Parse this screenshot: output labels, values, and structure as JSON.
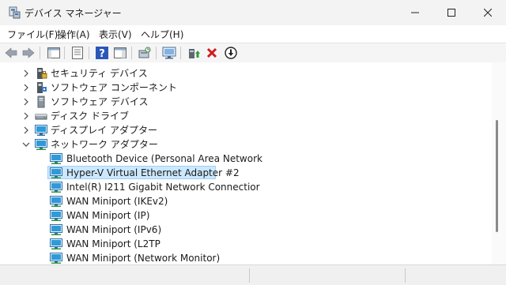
{
  "window": {
    "title": "デバイス マネージャー",
    "app_icon": "device-manager-icon",
    "controls": [
      "minimize-icon",
      "maximize-icon",
      "close-icon"
    ]
  },
  "menubar": {
    "items": [
      {
        "label": "ファイル(F)"
      },
      {
        "label": "操作(A)"
      },
      {
        "label": "表示(V)"
      },
      {
        "label": "ヘルプ(H)"
      }
    ]
  },
  "toolbar": {
    "buttons": [
      "back-icon",
      "forward-icon",
      "console-tree-icon",
      "properties-icon",
      "help-icon",
      "action-pane-icon",
      "scan-hardware-icon",
      "display-icon",
      "enable-device-icon",
      "uninstall-icon",
      "update-driver-icon"
    ]
  },
  "tree": {
    "categories": [
      {
        "label": "セキュリティ デバイス",
        "icon": "security-device-icon",
        "expanded": false
      },
      {
        "label": "ソフトウェア コンポーネント",
        "icon": "software-component-icon",
        "expanded": false
      },
      {
        "label": "ソフトウェア デバイス",
        "icon": "software-device-icon",
        "expanded": false
      },
      {
        "label": "ディスク ドライブ",
        "icon": "disk-drive-icon",
        "expanded": false
      },
      {
        "label": "ディスプレイ アダプター",
        "icon": "display-adapter-icon",
        "expanded": false
      },
      {
        "label": "ネットワーク アダプター",
        "icon": "network-adapter-icon",
        "expanded": true
      }
    ],
    "network_devices": [
      {
        "label": "Bluetooth Device (Personal Area Network",
        "selected": false
      },
      {
        "label": "Hyper-V Virtual Ethernet Adapter #2",
        "selected": true
      },
      {
        "label": "Intel(R) I211 Gigabit Network Connectior",
        "selected": false
      },
      {
        "label": "WAN Miniport (IKEv2)",
        "selected": false
      },
      {
        "label": "WAN Miniport (IP)",
        "selected": false
      },
      {
        "label": "WAN Miniport (IPv6)",
        "selected": false
      },
      {
        "label": "WAN Miniport (L2TP",
        "selected": false
      },
      {
        "label": "WAN Miniport (Network Monitor)",
        "selected": false
      }
    ]
  },
  "colors": {
    "selection_bg": "#cce8ff",
    "selection_border": "#99d1ff",
    "uninstall_red": "#d01c1c",
    "network_blue": "#1e88d6"
  }
}
